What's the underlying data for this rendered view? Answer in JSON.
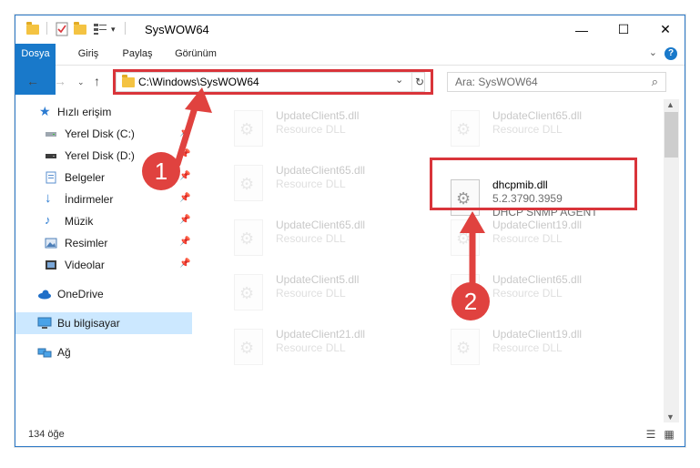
{
  "window": {
    "title": "SysWOW64"
  },
  "ribbon": {
    "tabs": [
      "Dosya",
      "Giriş",
      "Paylaş",
      "Görünüm"
    ]
  },
  "address": {
    "path": "C:\\Windows\\SysWOW64"
  },
  "search": {
    "placeholder": "Ara: SysWOW64"
  },
  "sidebar": {
    "items": [
      {
        "label": "Hızlı erişim",
        "icon": "star-icon"
      },
      {
        "label": "Yerel Disk (C:)",
        "icon": "drive-icon",
        "pinned": true
      },
      {
        "label": "Yerel Disk (D:)",
        "icon": "drive-icon",
        "pinned": true
      },
      {
        "label": "Belgeler",
        "icon": "documents-icon",
        "pinned": true
      },
      {
        "label": "İndirmeler",
        "icon": "download-icon",
        "pinned": true
      },
      {
        "label": "Müzik",
        "icon": "music-icon",
        "pinned": true
      },
      {
        "label": "Resimler",
        "icon": "pictures-icon",
        "pinned": true
      },
      {
        "label": "Videolar",
        "icon": "videos-icon",
        "pinned": true
      },
      {
        "label": "OneDrive",
        "icon": "cloud-icon"
      },
      {
        "label": "Bu bilgisayar",
        "icon": "computer-icon",
        "selected": true
      },
      {
        "label": "Ağ",
        "icon": "network-icon"
      }
    ]
  },
  "files": [
    {
      "name": "UpdateClient5.dll",
      "type": "Resource DLL"
    },
    {
      "name": "UpdateClient65.dll",
      "type": "Resource DLL"
    },
    {
      "name": "UpdateClient65.dll",
      "type": "Resource DLL"
    },
    {
      "name": "dhcpmib.dll",
      "version": "5.2.3790.3959",
      "description": "DHCP SNMP AGENT",
      "highlighted": true
    },
    {
      "name": "UpdateClient65.dll",
      "type": "Resource DLL"
    },
    {
      "name": "UpdateClient19.dll",
      "type": "Resource DLL"
    },
    {
      "name": "UpdateClient5.dll",
      "type": "Resource DLL"
    },
    {
      "name": "UpdateClient65.dll",
      "type": "Resource DLL"
    },
    {
      "name": "UpdateClient21.dll",
      "type": "Resource DLL"
    },
    {
      "name": "UpdateClient19.dll",
      "type": "Resource DLL"
    }
  ],
  "status": {
    "count": "134 öğe"
  },
  "annotations": {
    "step1": "1",
    "step2": "2",
    "color": "#d9343a"
  }
}
